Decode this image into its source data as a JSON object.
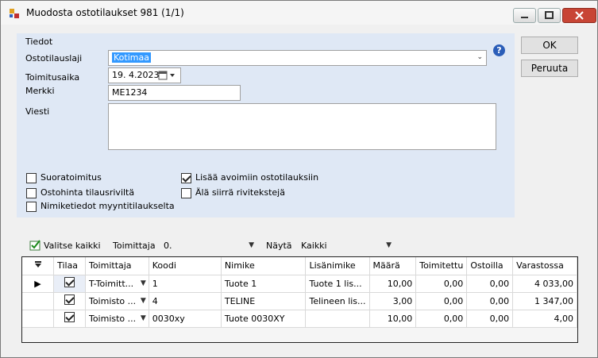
{
  "window": {
    "title": "Muodosta ostotilaukset 981 (1/1)"
  },
  "form": {
    "group_label": "Tiedot",
    "ostotilauslaji_label": "Ostotilauslaji",
    "ostotilauslaji_value": "Kotimaa",
    "toimitusaika_label": "Toimitusaika",
    "toimitusaika_value": "19.  4.2023",
    "merkki_label": "Merkki",
    "merkki_value": "ME1234",
    "viesti_label": "Viesti",
    "viesti_value": "",
    "checks": [
      {
        "label": "Suoratoimitus",
        "checked": false
      },
      {
        "label": "Ostohinta tilausriviltä",
        "checked": false
      },
      {
        "label": "Nimiketiedot myyntitilaukselta",
        "checked": false
      },
      {
        "label": "Lisää avoimiin ostotilauksiin",
        "checked": true
      },
      {
        "label": "Älä siirrä rivitekstejä",
        "checked": false
      }
    ]
  },
  "buttons": {
    "ok": "OK",
    "peruuta": "Peruuta"
  },
  "toolbar": {
    "valitse_kaikki": "Valitse kaikki",
    "toimittaja_label": "Toimittaja",
    "toimittaja_value": "0.",
    "nayta_label": "Näytä",
    "nayta_value": "Kaikki"
  },
  "table": {
    "headers": [
      "Tilaa",
      "Toimittaja",
      "Koodi",
      "Nimike",
      "Lisänimike",
      "Määrä",
      "Toimitettu",
      "Ostoilla",
      "Varastossa"
    ],
    "rows": [
      {
        "tilaa": true,
        "toimittaja": "T-Toimitt...",
        "koodi": "1",
        "nimike": "Tuote 1",
        "lisanimike": "Tuote 1 lis...",
        "maara": "10,00",
        "toimitettu": "0,00",
        "ostoilla": "0,00",
        "varastossa": "4 033,00"
      },
      {
        "tilaa": true,
        "toimittaja": "Toimisto ...",
        "koodi": "4",
        "nimike": "TELINE",
        "lisanimike": "Telineen lis...",
        "maara": "3,00",
        "toimitettu": "0,00",
        "ostoilla": "0,00",
        "varastossa": "1 347,00"
      },
      {
        "tilaa": true,
        "toimittaja": "Toimisto ...",
        "koodi": "0030xy",
        "nimike": "Tuote 0030XY",
        "lisanimike": "",
        "maara": "10,00",
        "toimitettu": "0,00",
        "ostoilla": "0,00",
        "varastossa": "4,00"
      }
    ]
  },
  "colors": {
    "panel": "#dfe8f5",
    "selection": "#3399ff",
    "close": "#c84535"
  }
}
